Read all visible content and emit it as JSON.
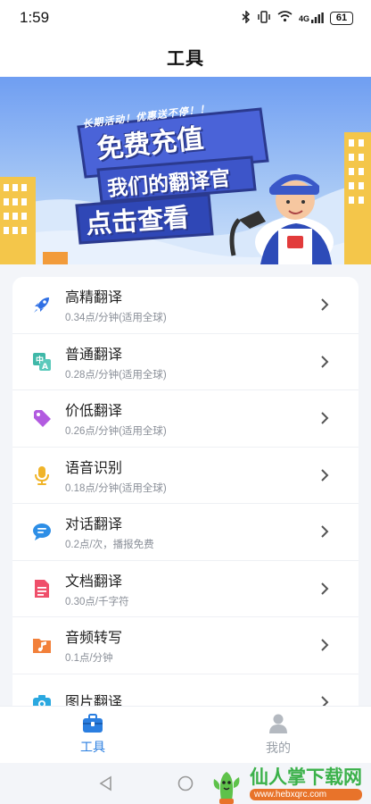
{
  "status_bar": {
    "time": "1:59",
    "network": "4G",
    "battery": "61"
  },
  "header": {
    "title": "工具"
  },
  "banner": {
    "subtitle": "长期活动！优惠送不停！！",
    "headline": "免费充值",
    "line2": "我们的翻译官",
    "cta": "点击查看"
  },
  "tools": [
    {
      "title": "高精翻译",
      "sub": "0.34点/分钟(适用全球)",
      "icon": "rocket-icon",
      "color": "#2f6fe4"
    },
    {
      "title": "普通翻译",
      "sub": "0.28点/分钟(适用全球)",
      "icon": "translate-icon",
      "color": "#3fb8a8"
    },
    {
      "title": "价低翻译",
      "sub": "0.26点/分钟(适用全球)",
      "icon": "price-tag-icon",
      "color": "#b25be0"
    },
    {
      "title": "语音识别",
      "sub": "0.18点/分钟(适用全球)",
      "icon": "microphone-icon",
      "color": "#f0b429"
    },
    {
      "title": "对话翻译",
      "sub": "0.2点/次，播报免费",
      "icon": "chat-bubble-icon",
      "color": "#2d8ee6"
    },
    {
      "title": "文档翻译",
      "sub": "0.30点/千字符",
      "icon": "document-icon",
      "color": "#ef4f6a"
    },
    {
      "title": "音频转写",
      "sub": "0.1点/分钟",
      "icon": "music-folder-icon",
      "color": "#f2803a"
    },
    {
      "title": "图片翻译",
      "sub": "",
      "icon": "camera-icon",
      "color": "#2aa8e0"
    }
  ],
  "bottom_nav": {
    "tools_label": "工具",
    "mine_label": "我的"
  },
  "watermark": {
    "text": "仙人掌下载网",
    "url": "www.hebxqrc.com"
  }
}
